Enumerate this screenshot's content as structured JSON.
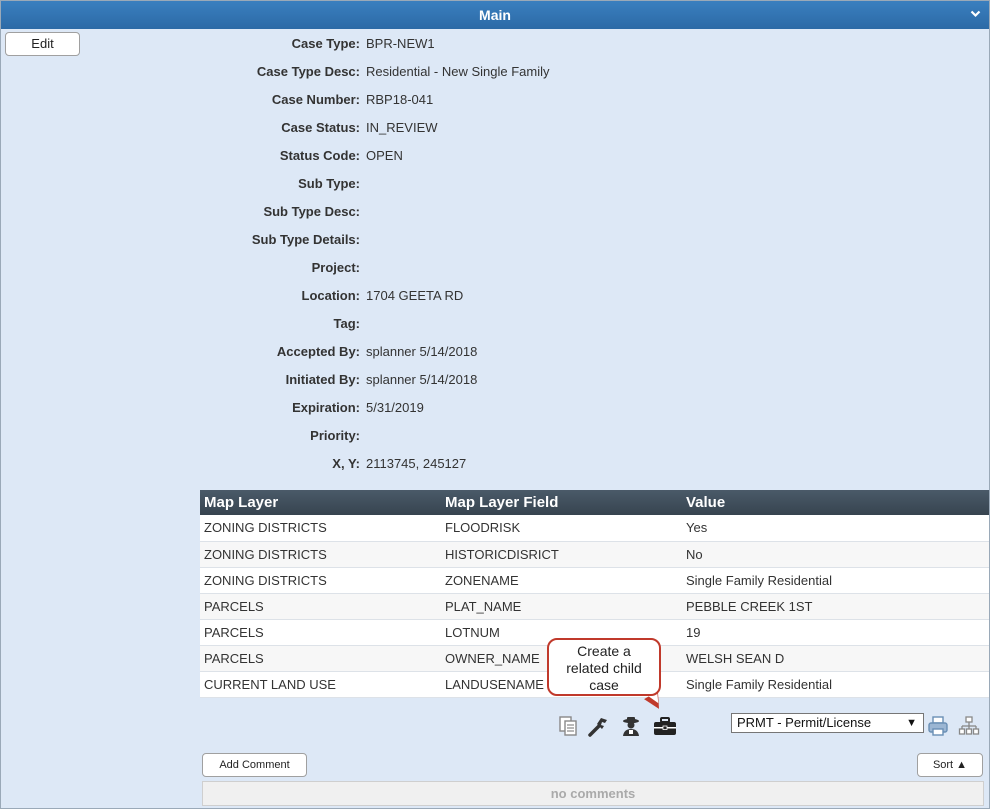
{
  "header": {
    "title": "Main",
    "collapse_icon": "chevron-down-icon"
  },
  "edit_label": "Edit",
  "fields": [
    {
      "label": "Case Type:",
      "value": "BPR-NEW1"
    },
    {
      "label": "Case Type Desc:",
      "value": "Residential - New Single Family"
    },
    {
      "label": "Case Number:",
      "value": "RBP18-041"
    },
    {
      "label": "Case Status:",
      "value": "IN_REVIEW"
    },
    {
      "label": "Status Code:",
      "value": "OPEN"
    },
    {
      "label": "Sub Type:",
      "value": ""
    },
    {
      "label": "Sub Type Desc:",
      "value": ""
    },
    {
      "label": "Sub Type Details:",
      "value": ""
    },
    {
      "label": "Project:",
      "value": ""
    },
    {
      "label": "Location:",
      "value": "1704 GEETA RD"
    },
    {
      "label": "Tag:",
      "value": ""
    },
    {
      "label": "Accepted By:",
      "value": "splanner 5/14/2018"
    },
    {
      "label": "Initiated By:",
      "value": "splanner 5/14/2018"
    },
    {
      "label": "Expiration:",
      "value": "5/31/2019"
    },
    {
      "label": "Priority:",
      "value": ""
    },
    {
      "label": "X, Y:",
      "value": "2113745, 245127"
    }
  ],
  "map_table": {
    "headers": [
      "Map Layer",
      "Map Layer Field",
      "Value"
    ],
    "rows": [
      [
        "ZONING DISTRICTS",
        "FLOODRISK",
        "Yes"
      ],
      [
        "ZONING DISTRICTS",
        "HISTORICDISRICT",
        "No"
      ],
      [
        "ZONING DISTRICTS",
        "ZONENAME",
        "Single Family Residential"
      ],
      [
        "PARCELS",
        "PLAT_NAME",
        "PEBBLE CREEK 1ST"
      ],
      [
        "PARCELS",
        "LOTNUM",
        "19"
      ],
      [
        "PARCELS",
        "OWNER_NAME",
        "WELSH SEAN D"
      ],
      [
        "CURRENT LAND USE",
        "LANDUSENAME",
        "Single Family Residential"
      ]
    ]
  },
  "tooltip": {
    "line1": "Create a",
    "line2": "related child",
    "line3": "case"
  },
  "toolbar": {
    "icons": [
      "copy-icon",
      "wrench-icon",
      "inspector-icon",
      "briefcase-icon",
      "print-icon",
      "sitemap-icon"
    ],
    "case_type_select": "PRMT - Permit/License"
  },
  "comments": {
    "add_label": "Add Comment",
    "sort_label": "Sort ▲",
    "empty_label": "no comments"
  }
}
